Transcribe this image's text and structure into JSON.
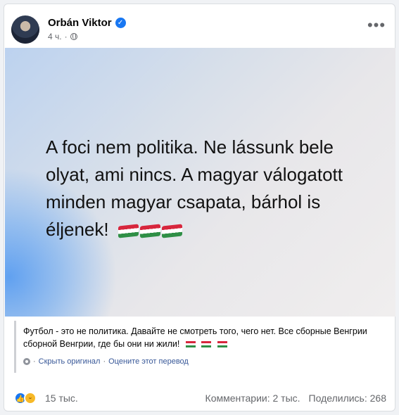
{
  "post": {
    "author": "Orbán Viktor",
    "time": "4 ч.",
    "more_label": "•••",
    "verified_mark": "✓"
  },
  "image": {
    "text": "A foci nem politika. Ne lássunk bele olyat, ami nincs. A magyar válogatott minden magyar csapata, bárhol is éljenek!",
    "flag_color_red": "#d7263d",
    "flag_color_white": "#ffffff",
    "flag_color_green": "#2f8f46"
  },
  "translation": {
    "text": "Футбол - это не политика. Давайте не смотреть того, чего нет. Все сборные Венгрии сборной Венгрии, где бы они ни жили!",
    "show_original": "Скрыть оригинал",
    "rate": "Оцените этот перевод",
    "separator": "·"
  },
  "stats": {
    "reactions": "15 тыс.",
    "comments": "Комментарии: 2 тыс.",
    "shares": "Поделились: 268"
  },
  "icons": {
    "verified": "verified-badge-icon",
    "privacy": "globe-icon",
    "options": "more-options-icon",
    "translation_settings": "gear-icon",
    "like": "like-reaction-icon",
    "haha": "haha-reaction-icon"
  },
  "colors": {
    "accent": "#1877f2",
    "link": "#385898",
    "secondary_text": "#65676b"
  }
}
